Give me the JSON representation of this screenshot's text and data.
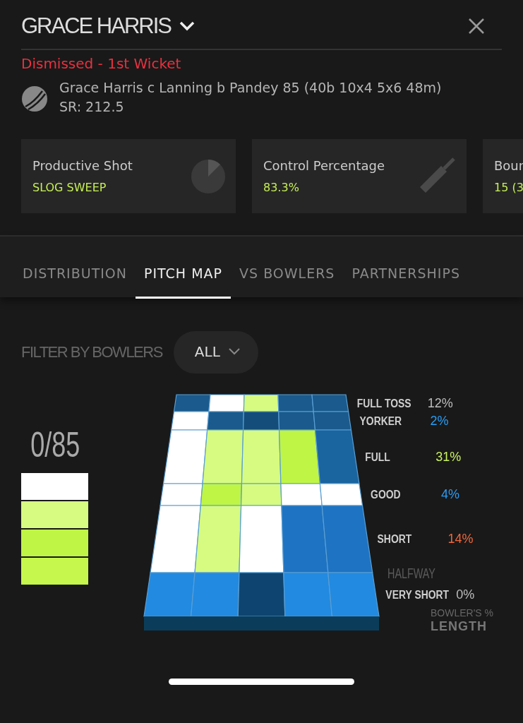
{
  "header": {
    "title": "GRACE HARRIS"
  },
  "dismissal": {
    "status": "Dismissed - 1st Wicket",
    "summary": "Grace Harris c Lanning b Pandey 85 (40b 10x4 5x6 48m)",
    "strike_rate": "SR: 212.5"
  },
  "stat_cards": [
    {
      "kind": "pie",
      "label": "Productive Shot",
      "value": "SLOG SWEEP"
    },
    {
      "kind": "bat",
      "label": "Control Percentage",
      "value": "83.3%"
    },
    {
      "kind": "none",
      "label": "Bour",
      "value": "15 (3"
    }
  ],
  "tabs": [
    {
      "label": "DISTRIBUTION",
      "selected": false
    },
    {
      "label": "PITCH MAP",
      "selected": true
    },
    {
      "label": "VS BOWLERS",
      "selected": false
    },
    {
      "label": "PARTNERSHIPS",
      "selected": false
    }
  ],
  "filter": {
    "label": "FILTER BY BOWLERS",
    "value": "ALL"
  },
  "legend": {
    "title": "0/85",
    "swatches": [
      {
        "color": "#ffffff"
      },
      {
        "color": "#d6fb80"
      },
      {
        "color": "#bff545"
      },
      {
        "color": "#c6f74c"
      }
    ]
  },
  "pitch": {
    "rows": [
      {
        "length": "FULL TOSS",
        "share": "12%",
        "color": "#bdbdbd",
        "cells": [
          {
            "color": "#1a5a8c"
          },
          {
            "color": "#ffffff"
          },
          {
            "color": "#d6fb80"
          },
          {
            "color": "#1a5a8c"
          },
          {
            "color": "#1a5a8c"
          }
        ]
      },
      {
        "length": "YORKER",
        "share": "2%",
        "color": "#2a9df4",
        "cells": [
          {
            "color": "#ffffff"
          },
          {
            "color": "#1a5a8c"
          },
          {
            "color": "#144d7a"
          },
          {
            "color": "#1a5a8c"
          },
          {
            "color": "#1a5a8c"
          }
        ]
      },
      {
        "length": "FULL",
        "share": "31%",
        "color": "#c8f060",
        "cells": [
          {
            "color": "#ffffff"
          },
          {
            "color": "#d6fb80"
          },
          {
            "color": "#d6fb80"
          },
          {
            "color": "#bff545"
          },
          {
            "color": "#1a64a0"
          }
        ]
      },
      {
        "length": "GOOD",
        "share": "4%",
        "color": "#2a9df4",
        "cells": [
          {
            "color": "#ffffff"
          },
          {
            "color": "#bff545"
          },
          {
            "color": "#d6fb80"
          },
          {
            "color": "#ffffff"
          },
          {
            "color": "#ffffff"
          }
        ]
      },
      {
        "length": "SHORT",
        "share": "14%",
        "color": "#f0673a",
        "cells": [
          {
            "color": "#ffffff"
          },
          {
            "color": "#d6fb80"
          },
          {
            "color": "#ffffff"
          },
          {
            "color": "#1e73c2"
          },
          {
            "color": "#1e73c2"
          }
        ]
      },
      {
        "length": "VERY SHORT",
        "share": "0%",
        "color": "#bdbdbd",
        "cells": [
          {
            "color": "#228ae0"
          },
          {
            "color": "#228ae0"
          },
          {
            "color": "#0e4570"
          },
          {
            "color": "#228ae0"
          },
          {
            "color": "#228ae0"
          }
        ]
      }
    ],
    "halfway": "HALFWAY",
    "caption_top": "BOWLER'S %",
    "caption_bottom": "LENGTH"
  }
}
